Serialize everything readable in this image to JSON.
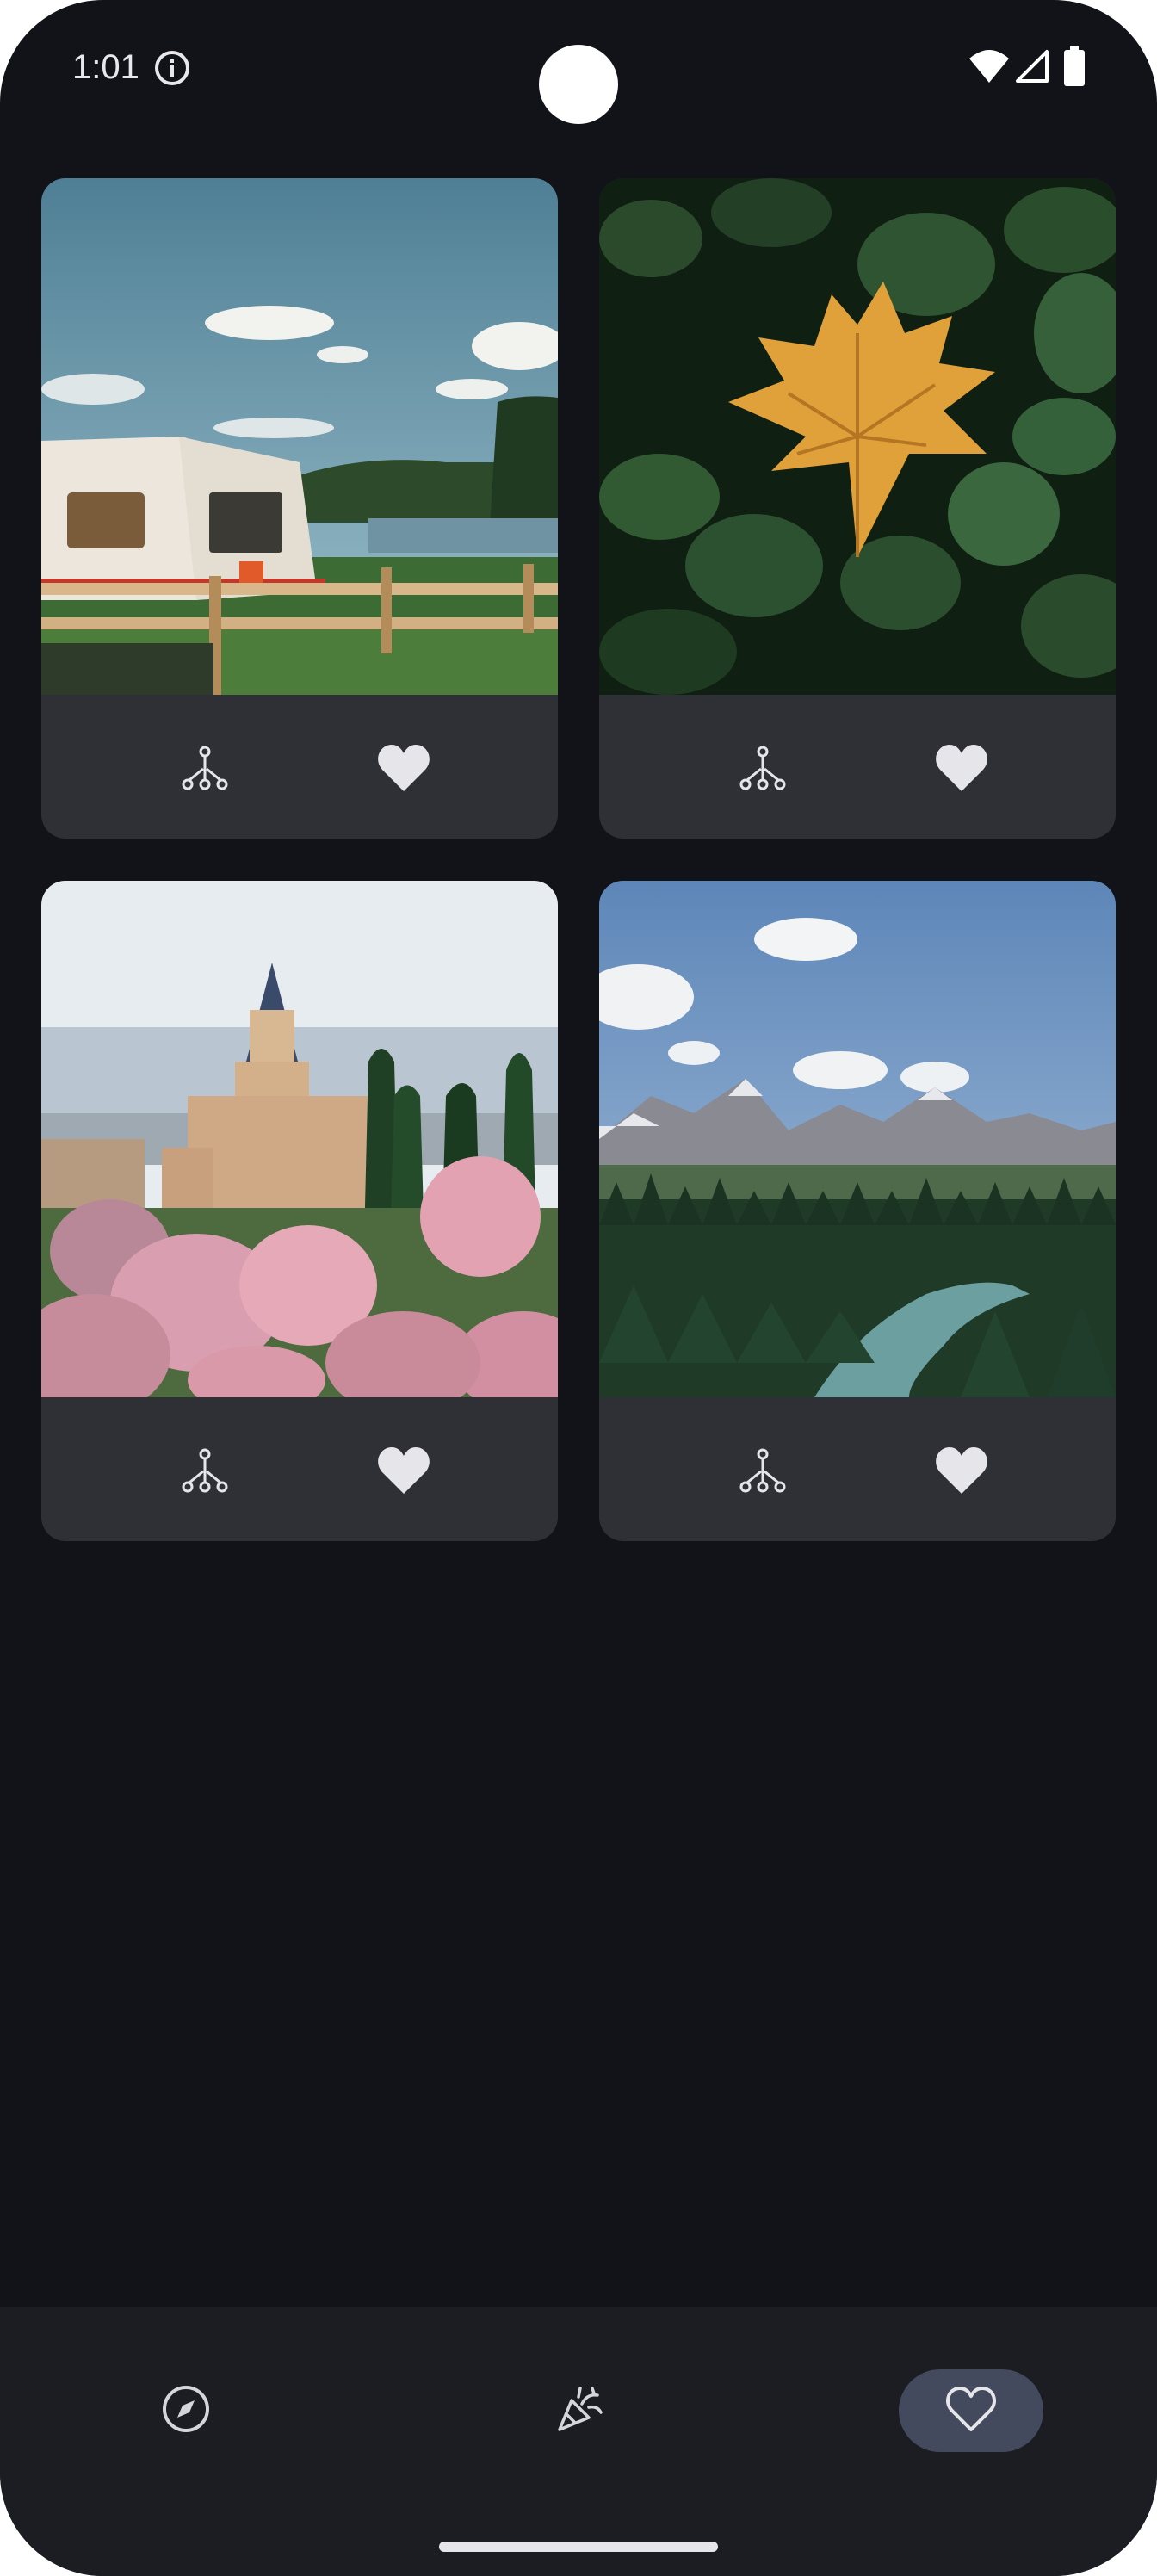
{
  "status_bar": {
    "time": "1:01",
    "icons": [
      "info-icon",
      "wifi-icon",
      "signal-icon",
      "battery-icon"
    ]
  },
  "photos": [
    {
      "subject": "camper-trailer-lakeside",
      "actions": [
        "share-icon",
        "heart-icon"
      ],
      "liked": true
    },
    {
      "subject": "autumn-maple-leaf-on-nettles",
      "actions": [
        "share-icon",
        "heart-icon"
      ],
      "liked": true
    },
    {
      "subject": "church-tower-with-pink-flowers",
      "actions": [
        "share-icon",
        "heart-icon"
      ],
      "liked": true
    },
    {
      "subject": "mountain-valley-river-forest",
      "actions": [
        "share-icon",
        "heart-icon"
      ],
      "liked": true
    }
  ],
  "bottom_nav": {
    "items": [
      {
        "icon": "compass-icon",
        "selected": false
      },
      {
        "icon": "party-popper-icon",
        "selected": false
      },
      {
        "icon": "heart-outline-icon",
        "selected": true
      }
    ]
  },
  "colors": {
    "background": "#121318",
    "card": "#2f3036",
    "nav_background": "#1c1d23",
    "nav_selected_pill": "#434a5e",
    "icon": "#e6e6ea"
  }
}
